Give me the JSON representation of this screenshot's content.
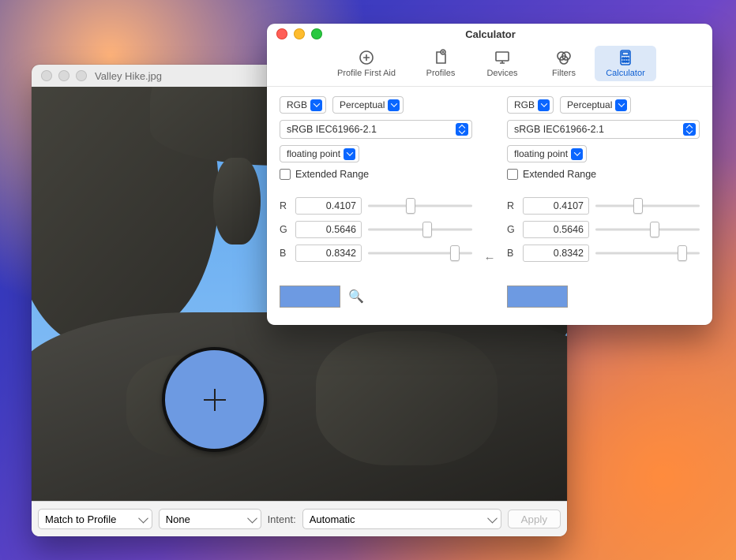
{
  "image_window": {
    "title": "Valley Hike.jpg",
    "action_select": "Match to Profile",
    "profile_select": "None",
    "intent_label": "Intent:",
    "intent_select": "Automatic",
    "apply_label": "Apply"
  },
  "calc_window": {
    "title": "Calculator",
    "tabs": {
      "first_aid": "Profile First Aid",
      "profiles": "Profiles",
      "devices": "Devices",
      "filters": "Filters",
      "calculator": "Calculator"
    },
    "left": {
      "space": "RGB",
      "intent": "Perceptual",
      "profile": "sRGB IEC61966-2.1",
      "format": "floating point",
      "extended": "Extended Range",
      "r_label": "R",
      "g_label": "G",
      "b_label": "B",
      "r": "0.4107",
      "g": "0.5646",
      "b": "0.8342",
      "swatch_color": "#6d9ae2"
    },
    "arrow": "←",
    "right": {
      "space": "RGB",
      "intent": "Perceptual",
      "profile": "sRGB IEC61966-2.1",
      "format": "floating point",
      "extended": "Extended Range",
      "r_label": "R",
      "g_label": "G",
      "b_label": "B",
      "r": "0.4107",
      "g": "0.5646",
      "b": "0.8342",
      "swatch_color": "#6d9ae2"
    }
  }
}
